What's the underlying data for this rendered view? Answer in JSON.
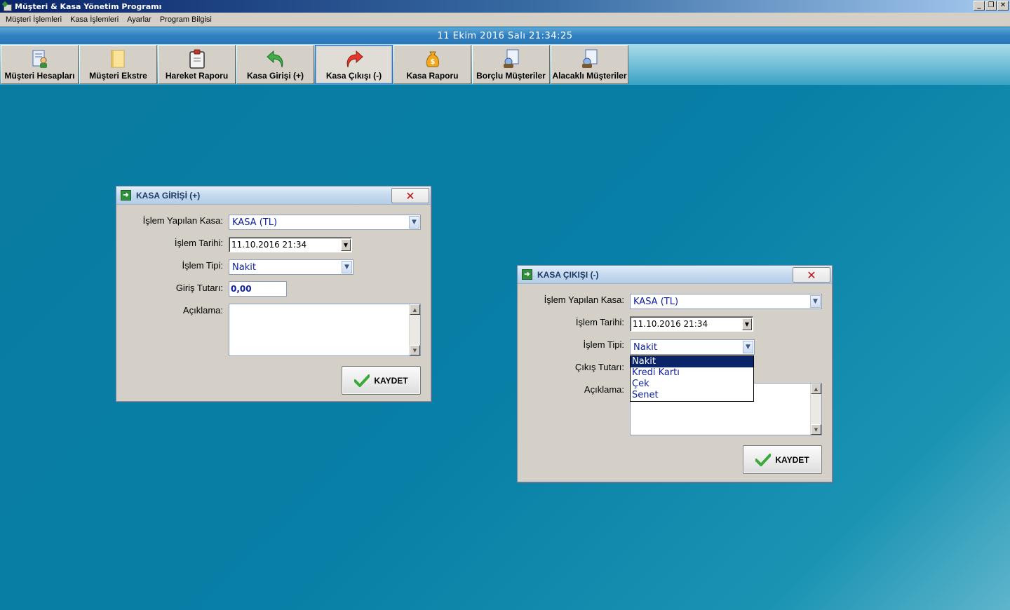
{
  "window": {
    "title": "Müşteri & Kasa Yönetim Programı",
    "buttons": [
      "_",
      "❐",
      "✕"
    ]
  },
  "menu": [
    "Müşteri İşlemleri",
    "Kasa İşlemleri",
    "Ayarlar",
    "Program Bilgisi"
  ],
  "datebar": "11 Ekim 2016 Salı 21:34:25",
  "toolbar": [
    {
      "label": "Müşteri Hesapları",
      "icon": "customer-accounts-icon"
    },
    {
      "label": "Müşteri Ekstre",
      "icon": "folder-icon"
    },
    {
      "label": "Hareket Raporu",
      "icon": "clipboard-icon"
    },
    {
      "label": "Kasa Girişi (+)",
      "icon": "green-back-arrow-icon"
    },
    {
      "label": "Kasa Çıkışı (-)",
      "icon": "red-forward-arrow-icon"
    },
    {
      "label": "Kasa Raporu",
      "icon": "money-bag-icon"
    },
    {
      "label": "Borçlu Müşteriler",
      "icon": "debtor-customers-icon"
    },
    {
      "label": "Alacaklı Müşteriler",
      "icon": "creditor-customers-icon"
    }
  ],
  "toolbar_active": "Kasa Çıkışı (-)",
  "dialog_in": {
    "title": "KASA GİRİŞİ (+)",
    "close": "✕",
    "kasa_label": "İşlem Yapılan Kasa:",
    "kasa_value": "KASA (TL)",
    "tarih_label": "İşlem Tarihi:",
    "tarih_value": "11.10.2016 21:34",
    "tip_label": "İşlem Tipi:",
    "tip_value": "Nakit",
    "tutar_label": "Giriş Tutarı:",
    "tutar_value": "0,00",
    "aciklama_label": "Açıklama:",
    "save": "KAYDET"
  },
  "dialog_out": {
    "title": "KASA ÇIKIŞI (-)",
    "close": "✕",
    "kasa_label": "İşlem Yapılan Kasa:",
    "kasa_value": "KASA (TL)",
    "tarih_label": "İşlem Tarihi:",
    "tarih_value": "11.10.2016 21:34",
    "tip_label": "İşlem Tipi:",
    "tip_value": "Nakit",
    "tutar_label": "Çıkış Tutarı:",
    "aciklama_label": "Açıklama:",
    "save": "KAYDET",
    "tip_options": [
      "Nakit",
      "Kredi Kartı",
      "Çek",
      "Senet"
    ],
    "tip_selected": "Nakit"
  }
}
